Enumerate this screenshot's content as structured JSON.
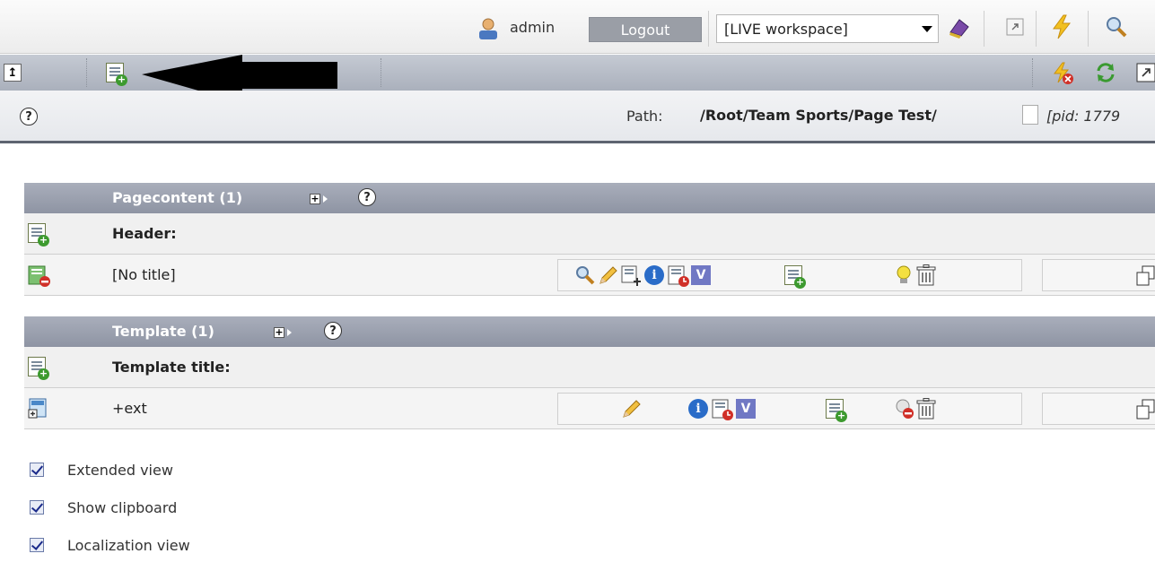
{
  "topbar": {
    "username": "admin",
    "logout_label": "Logout",
    "workspace_selected": "[LIVE workspace]"
  },
  "pathbar": {
    "path_label": "Path:",
    "path_value": "/Root/Team Sports/Page Test/",
    "pid_text": "[pid: 1779"
  },
  "sections": [
    {
      "title": "Pagecontent (1)",
      "header_label": "Header:",
      "record_label": "[No title]"
    },
    {
      "title": "Template (1)",
      "header_label": "Template title:",
      "record_label": "+ext"
    }
  ],
  "help_glyph": "?",
  "options": {
    "extended_view": "Extended view",
    "show_clipboard": "Show clipboard",
    "localization_view": "Localization view"
  }
}
